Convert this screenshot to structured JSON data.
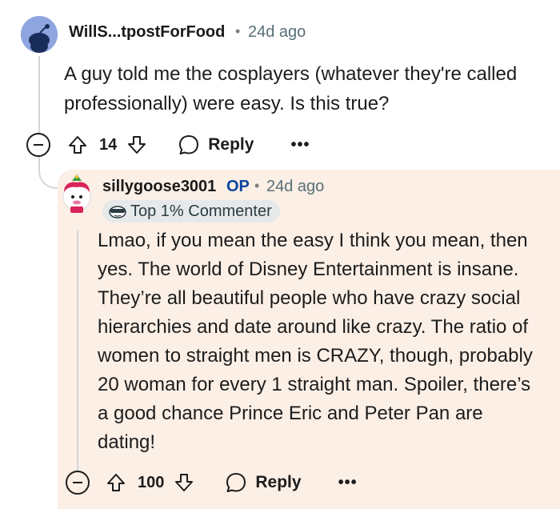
{
  "parent_comment": {
    "username": "WillS...tpostForFood",
    "separator": "•",
    "timestamp": "24d ago",
    "body": "A guy told me the cosplayers (whatever they're called professionally) were easy. Is this true?",
    "vote_count": "14",
    "reply_label": "Reply",
    "more_label": "•••",
    "avatar_color": "#8fa5df"
  },
  "reply_comment": {
    "username": "sillygoose3001",
    "op_label": "OP",
    "separator": "•",
    "timestamp": "24d ago",
    "badge_label": "Top 1% Commenter",
    "body": "Lmao, if you mean the easy I think you mean, then yes. The world of Disney Entertainment is insane. They’re all beautiful people who have crazy social hierarchies and date around like crazy. The ratio of women to straight men is CRAZY, though, probably 20 woman for every 1 straight man. Spoiler, there’s a good chance Prince Eric and Peter Pan are dating!",
    "vote_count": "100",
    "reply_label": "Reply",
    "more_label": "•••",
    "highlight_color": "#fcefe6",
    "op_color": "#0a449b"
  }
}
